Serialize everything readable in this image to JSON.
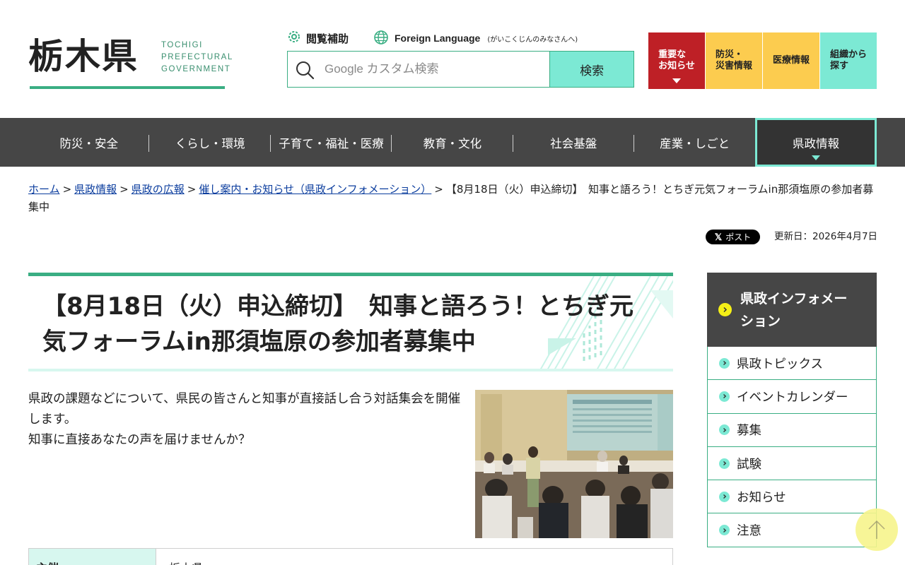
{
  "header": {
    "logo_kanji": "栃木県",
    "logo_en_line1": "TOCHIGI",
    "logo_en_line2": "PREFECTURAL",
    "logo_en_line3": "GOVERNMENT",
    "accessibility_label": "閲覧補助",
    "foreign_language_label": "Foreign Language",
    "foreign_language_sub": "(がいこくじんのみなさんへ)",
    "search_placeholder": "Google カスタム検索",
    "search_button": "検索",
    "quick_links": [
      {
        "line1": "重要な",
        "line2": "お知らせ",
        "color": "#be2026"
      },
      {
        "line1": "防災・",
        "line2": "災害情報",
        "color": "#fccc4f"
      },
      {
        "line1": "医療情報",
        "line2": "",
        "color": "#fccc4f"
      },
      {
        "line1": "組織から",
        "line2": "探す",
        "color": "#7ce9d4"
      }
    ]
  },
  "global_nav": {
    "items": [
      {
        "label": "防災・安全"
      },
      {
        "label": "くらし・環境"
      },
      {
        "label": "子育て・福祉・医療"
      },
      {
        "label": "教育・文化"
      },
      {
        "label": "社会基盤"
      },
      {
        "label": "産業・しごと"
      },
      {
        "label": "県政情報",
        "active": true
      }
    ]
  },
  "breadcrumb": {
    "links": [
      "ホーム",
      "県政情報",
      "県政の広報",
      "催し案内・お知らせ（県政インフォメーション）"
    ],
    "separator": ">",
    "current": "【8月18日（火）申込締切】　知事と語ろう！とちぎ元気フォーラムin那須塩原の参加者募集中"
  },
  "share_label": "ポスト",
  "updated_label": "更新日：2026年4月7日",
  "main": {
    "title": "【8月18日（火）申込締切】　知事と語ろう！とちぎ元気フォーラムin那須塩原の参加者募集中",
    "intro_line1": "県政の課題などについて、県民の皆さんと知事が直接話し合う対話集会を開催します。",
    "intro_line2": "知事に直接あなたの声を届けませんか？",
    "table": {
      "header": "主催",
      "value": "栃木県"
    }
  },
  "side_nav": {
    "title": "県政インフォメーション",
    "items": [
      "県政トピックス",
      "イベントカレンダー",
      "募集",
      "試験",
      "お知らせ",
      "注意"
    ]
  },
  "colors": {
    "brand_green": "#3aae83",
    "mint": "#7ce9d4",
    "nav_bg": "#464646",
    "alert_red": "#be2026",
    "yellow": "#fccc4f"
  }
}
